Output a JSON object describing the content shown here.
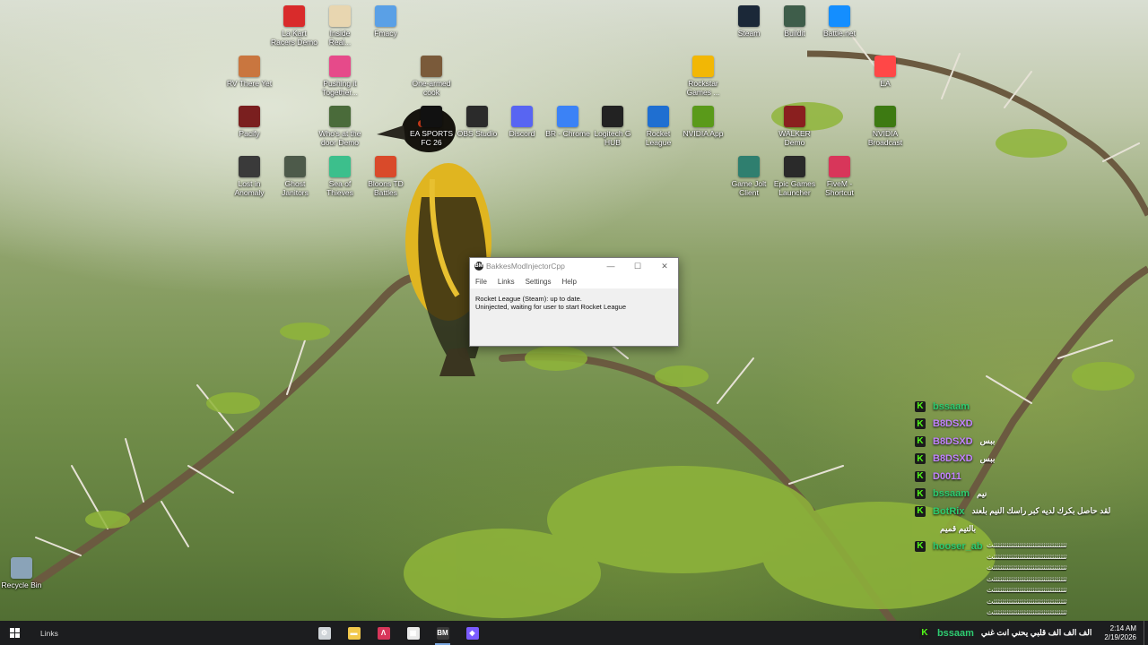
{
  "desktop_icons": [
    {
      "id": "icon-1",
      "label": "La Kart\nRacers Demo",
      "icon": "red-cap-icon",
      "color": "#d92b2b"
    },
    {
      "id": "icon-2",
      "label": "Inside\nReal...",
      "icon": "anime-face-icon",
      "color": "#e8d6b0"
    },
    {
      "id": "icon-3",
      "label": "Fmacy",
      "icon": "f-app-icon",
      "color": "#5aa0e6"
    },
    {
      "id": "icon-4",
      "label": "Steam",
      "icon": "steam-icon",
      "color": "#1b2838"
    },
    {
      "id": "icon-5",
      "label": "Buildit",
      "icon": "city-icon",
      "color": "#3e5d4a"
    },
    {
      "id": "icon-6",
      "label": "Battle.net",
      "icon": "battlenet-icon",
      "color": "#148eff"
    },
    {
      "id": "icon-7",
      "label": "RV There Yet",
      "icon": "rv-icon",
      "color": "#c9763f"
    },
    {
      "id": "icon-8",
      "label": "Pushing it\nTogether...",
      "icon": "pink-ball-icon",
      "color": "#e64a8a"
    },
    {
      "id": "icon-9",
      "label": "One-armed\ncook",
      "icon": "chef-icon",
      "color": "#7a5a3a"
    },
    {
      "id": "icon-10",
      "label": "Rockstar\nGames ...",
      "icon": "rockstar-icon",
      "color": "#f2b705"
    },
    {
      "id": "icon-11",
      "label": "EA",
      "icon": "ea-icon",
      "color": "#ff4747"
    },
    {
      "id": "icon-12",
      "label": "Pacify",
      "icon": "pacify-icon",
      "color": "#7a1f1f"
    },
    {
      "id": "icon-13",
      "label": "Who's at the\ndoor Demo",
      "icon": "door-icon",
      "color": "#4a6b3a"
    },
    {
      "id": "icon-14",
      "label": "EA SPORTS\nFC 26",
      "icon": "fc26-icon",
      "color": "#111111"
    },
    {
      "id": "icon-15",
      "label": "OBS Studio",
      "icon": "obs-icon",
      "color": "#2b2b2b"
    },
    {
      "id": "icon-16",
      "label": "Discord",
      "icon": "discord-icon",
      "color": "#5865f2"
    },
    {
      "id": "icon-17",
      "label": "BR - Chrome",
      "icon": "chrome-icon",
      "color": "#3b82f6"
    },
    {
      "id": "icon-18",
      "label": "Logitech G\nHUB",
      "icon": "logitech-icon",
      "color": "#222222"
    },
    {
      "id": "icon-19",
      "label": "Rocket\nLeague",
      "icon": "rocket-league-icon",
      "color": "#1f6fd1"
    },
    {
      "id": "icon-20",
      "label": "NVIDIA App",
      "icon": "nvidia-icon",
      "color": "#5a9a1a"
    },
    {
      "id": "icon-21",
      "label": "WALKER\nDemo",
      "icon": "walker-icon",
      "color": "#8a1f1f"
    },
    {
      "id": "icon-22",
      "label": "NVIDIA\nBroadcast",
      "icon": "nvidia-broadcast-icon",
      "color": "#3d7a12"
    },
    {
      "id": "icon-23",
      "label": "Lost in\nAnomaly",
      "icon": "anomaly-icon",
      "color": "#3a3a3a"
    },
    {
      "id": "icon-24",
      "label": "Ghost\nJanitors",
      "icon": "ghost-icon",
      "color": "#4d5a4a"
    },
    {
      "id": "icon-25",
      "label": "Sea of\nThieves",
      "icon": "skull-icon",
      "color": "#3cbf8c"
    },
    {
      "id": "icon-26",
      "label": "Bloons TD\nBattles",
      "icon": "balloon-icon",
      "color": "#d94a2a"
    },
    {
      "id": "icon-27",
      "label": "Game Jolt\nClient",
      "icon": "gamejolt-icon",
      "color": "#2f7f6f"
    },
    {
      "id": "icon-28",
      "label": "Epic Games\nLauncher",
      "icon": "epic-icon",
      "color": "#2a2a2a"
    },
    {
      "id": "icon-29",
      "label": "FiveM -\nShortcut",
      "icon": "fivem-icon",
      "color": "#d8365a"
    },
    {
      "id": "icon-30",
      "label": "Recycle Bin",
      "icon": "recycle-bin-icon",
      "color": "#8aa3b8"
    }
  ],
  "window": {
    "title": "BakkesModInjectorCpp",
    "app_icon_text": "BM",
    "menu": [
      "File",
      "Links",
      "Settings",
      "Help"
    ],
    "status_line1": "Rocket League (Steam): up to date.",
    "status_line2": "Uninjected, waiting for user to start Rocket League"
  },
  "chat": {
    "messages": [
      {
        "user": "bssaam",
        "color": "#2ecc71",
        "text": ""
      },
      {
        "user": "B8DSXD",
        "color": "#c283ff",
        "text": ""
      },
      {
        "user": "B8DSXD",
        "color": "#c283ff",
        "text": "ببس"
      },
      {
        "user": "B8DSXD",
        "color": "#c283ff",
        "text": "ببس"
      },
      {
        "user": "D0011",
        "color": "#c283ff",
        "text": ""
      },
      {
        "user": "bssaam",
        "color": "#2ecc71",
        "text": "نيم"
      },
      {
        "user": "BotRix",
        "color": "#2ecc71",
        "text": "لقد حاصل بكرك لديه كبر راسك النيم بلعند"
      },
      {
        "user": "",
        "color": "#2ecc71",
        "text": "بالتيم قميم"
      },
      {
        "user": "hooser_ab",
        "color": "#2ecc71",
        "text": ""
      }
    ],
    "spam_lines": [
      "ثثثثثثثثثثثثثثثثثثثثثثثثثثثثثثثثثثث",
      "ثثثثثثثثثثثثثثثثثثثثثثثثثثثثثثثثثثث",
      "ثثثثثثثثثثثثثثثثثثثثثثثثثثثثثثثثثثث",
      "ثثثثثثثثثثثثثثثثثثثثثثثثثثثثثثثثثثث",
      "ثثثثثثثثثثثثثثثثثثثثثثثثثثثثثثثثثثث",
      "ثثثثثثثثثثثثثثثثثثثثثثثثثثثثثثثثثثث",
      "ثثثثثثثثثثثثثثثثثثثثثثثثثثثثثثثثثثث"
    ]
  },
  "taskbar": {
    "links_label": "Links",
    "apps": [
      {
        "icon": "steam-overlay-icon",
        "color": "#cfd4d8",
        "active": false
      },
      {
        "icon": "file-explorer-icon",
        "color": "#f2c94c",
        "active": false
      },
      {
        "icon": "fivem-icon",
        "color": "#d8365a",
        "active": false
      },
      {
        "icon": "store-icon",
        "color": "#e9e9e9",
        "active": false
      },
      {
        "icon": "bakkesmod-icon",
        "color": "#3a3a3a",
        "active": true
      },
      {
        "icon": "purple-app-icon",
        "color": "#7b5cff",
        "active": false
      }
    ],
    "chat_user": "bssaam",
    "chat_text": "الف الف الف قلبي يحني انت غني",
    "time": "2:14 AM",
    "date": "2/19/2026"
  }
}
